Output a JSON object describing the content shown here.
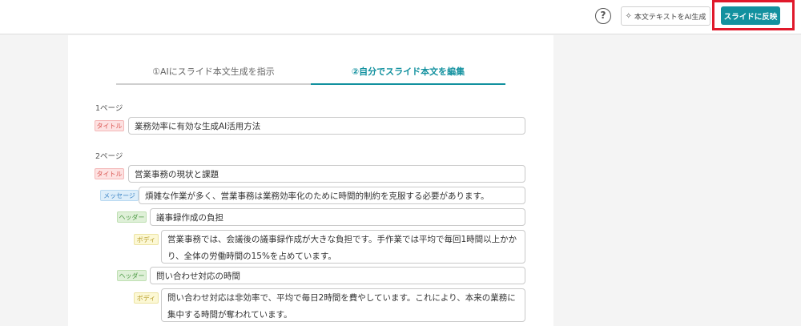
{
  "header": {
    "help_icon_text": "?",
    "ai_generate_label": "本文テキストをAI生成",
    "reflect_label": "スライドに反映"
  },
  "tabs": [
    {
      "label": "①AIにスライド本文生成を指示",
      "active": false
    },
    {
      "label": "②自分でスライド本文を編集",
      "active": true
    }
  ],
  "tag_labels": {
    "title": "タイトル",
    "message": "メッセージ",
    "header": "ヘッダー",
    "body": "ボディ"
  },
  "pages": [
    {
      "label": "1ページ",
      "title": "業務効率に有効な生成AI活用方法"
    },
    {
      "label": "2ページ",
      "title": "営業事務の現状と課題",
      "message": "煩雑な作業が多く、営業事務は業務効率化のために時間的制約を克服する必要があります。",
      "sections": [
        {
          "header": "議事録作成の負担",
          "body": "営業事務では、会議後の議事録作成が大きな負担です。手作業では平均で毎回1時間以上かかり、全体の労働時間の15%を占めています。"
        },
        {
          "header": "問い合わせ対応の時間",
          "body": "問い合わせ対応は非効率で、平均で毎日2時間を費やしています。これにより、本来の業務に集中する時間が奪われています。"
        }
      ]
    }
  ],
  "colors": {
    "accent": "#12919f",
    "highlight": "#e0192b"
  }
}
